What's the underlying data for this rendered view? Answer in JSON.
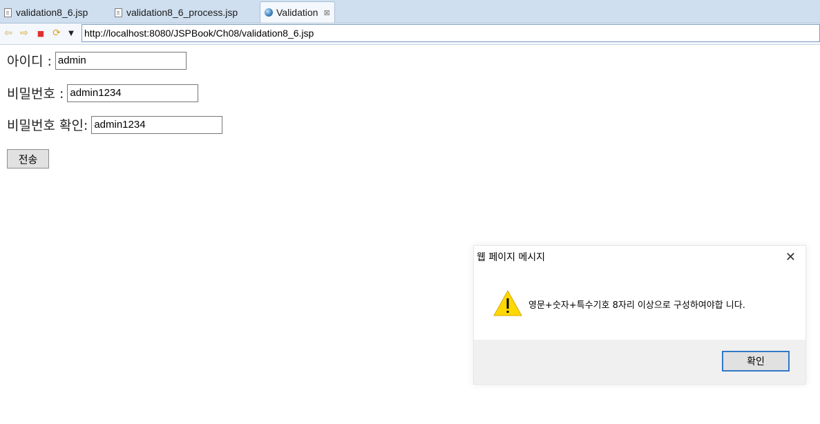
{
  "tabs": [
    {
      "label": "validation8_6.jsp",
      "icon": "file-icon"
    },
    {
      "label": "validation8_6_process.jsp",
      "icon": "file-icon"
    },
    {
      "label": "Validation",
      "icon": "globe-icon",
      "active": true,
      "close": "⊠"
    }
  ],
  "toolbar": {
    "back_icon": "⇦",
    "forward_icon": "⇨",
    "stop_icon": "■",
    "refresh_icon": "⟳",
    "dropdown_icon": "▼",
    "url": "http://localhost:8080/JSPBook/Ch08/validation8_6.jsp"
  },
  "form": {
    "id_label": "아이디 :",
    "id_value": "admin",
    "password_label": "비밀번호 :",
    "password_value": "admin1234",
    "password_confirm_label": "비밀번호 확인:",
    "password_confirm_value": "admin1234",
    "submit_label": "전송"
  },
  "dialog": {
    "title": "웹 페이지 메시지",
    "close_icon": "✕",
    "message": "영문+숫자+특수기호 8자리 이상으로 구성하여야합 니다.",
    "ok_label": "확인"
  },
  "colors": {
    "tabbar_bg": "#cfdff0",
    "dialog_button_border": "#2f78c8",
    "warning_yellow": "#ffd800"
  }
}
